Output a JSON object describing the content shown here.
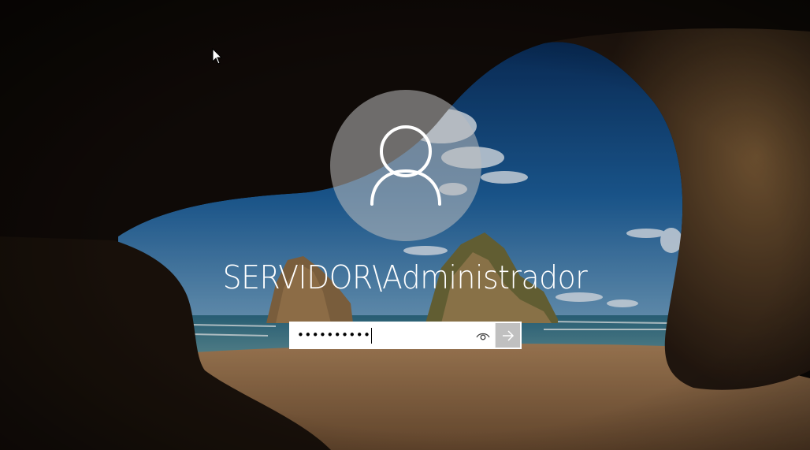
{
  "login": {
    "username": "SERVIDOR\\Administrador",
    "password_masked": "••••••••••",
    "reveal_icon": "eye-icon",
    "submit_icon": "arrow-right-icon",
    "avatar_icon": "user-icon"
  },
  "colors": {
    "sky_top": "#0b3a73",
    "sky_mid": "#1f66a8",
    "sea": "#2b6f8a",
    "sand": "#b88a5a",
    "cave": "#1b120c",
    "text": "#ffffff"
  }
}
